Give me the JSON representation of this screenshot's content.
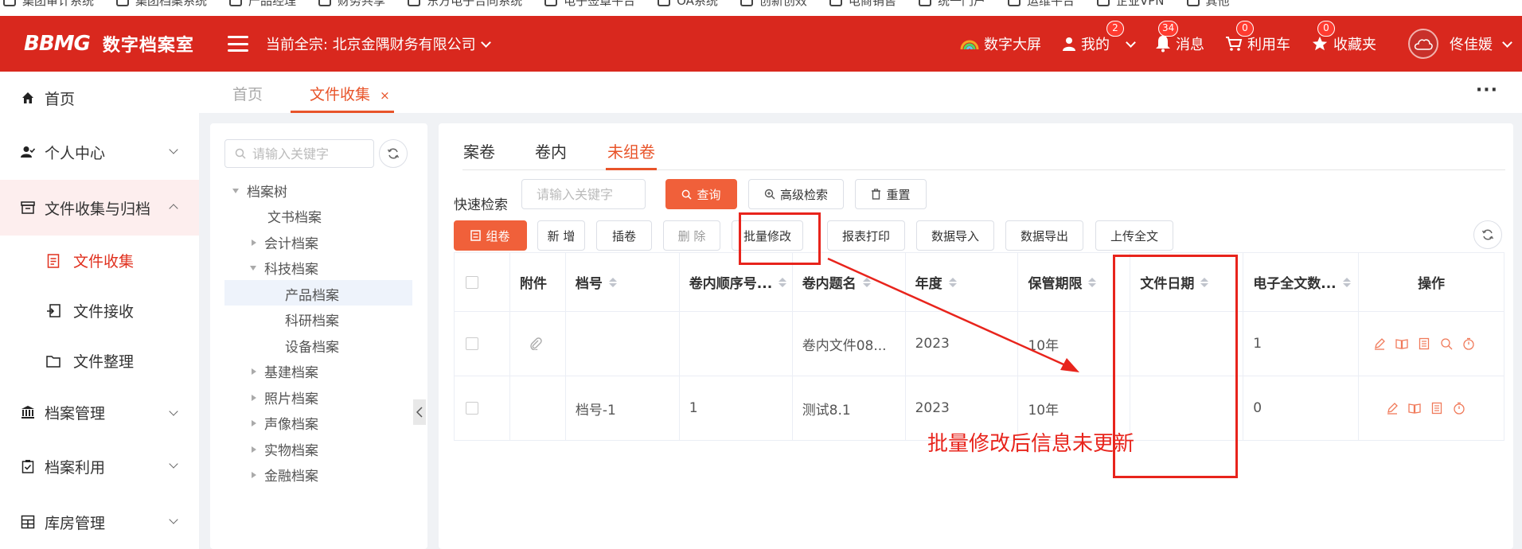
{
  "browser": {
    "bookmarks": [
      "集团审计系统",
      "集团档案系统",
      "产品经理",
      "财务共享",
      "东方电子合同系统",
      "电子签章平台",
      "OA系统",
      "创新创效",
      "电商销售",
      "统一门户",
      "运维平台",
      "企业VPN",
      "其他"
    ]
  },
  "header": {
    "logo": "BBMG",
    "title": "数字档案室",
    "company_label": "当前全宗: 北京金隅财务有限公司",
    "big_screen": "数字大屏",
    "mine": "我的",
    "mine_badge": "2",
    "messages": "消息",
    "messages_badge": "34",
    "cart": "利用车",
    "cart_badge": "0",
    "favorites": "收藏夹",
    "favorites_badge": "0",
    "user": "佟佳媛"
  },
  "sidebar": {
    "items": [
      {
        "label": "首页"
      },
      {
        "label": "个人中心"
      },
      {
        "label": "文件收集与归档"
      },
      {
        "label": "文件收集"
      },
      {
        "label": "文件接收"
      },
      {
        "label": "文件整理"
      },
      {
        "label": "档案管理"
      },
      {
        "label": "档案利用"
      },
      {
        "label": "库房管理"
      }
    ]
  },
  "page_tabs": {
    "home": "首页",
    "current": "文件收集",
    "close": "×"
  },
  "tree": {
    "search_placeholder": "请输入关键字",
    "nodes": [
      "档案树",
      "文书档案",
      "会计档案",
      "科技档案",
      "产品档案",
      "科研档案",
      "设备档案",
      "基建档案",
      "照片档案",
      "声像档案",
      "实物档案",
      "金融档案"
    ]
  },
  "content_tabs": [
    "案卷",
    "卷内",
    "未组卷"
  ],
  "toolbar": {
    "quick_search_label": "快速检索",
    "quick_search_placeholder": "请输入关键字",
    "query": "查询",
    "advanced": "高级检索",
    "reset": "重置",
    "group": "组卷",
    "add": "新 增",
    "insert": "插卷",
    "delete": "删 除",
    "batch_edit": "批量修改",
    "print": "报表打印",
    "import": "数据导入",
    "export": "数据导出",
    "upload": "上传全文"
  },
  "table": {
    "headers": [
      "附件",
      "档号",
      "卷内顺序号...",
      "卷内题名",
      "年度",
      "保管期限",
      "文件日期",
      "电子全文数...",
      "操作"
    ],
    "rows": [
      {
        "attach": "📎",
        "code": "",
        "seq": "",
        "title": "卷内文件08...",
        "year": "2023",
        "period": "10年",
        "date": "",
        "count": "1"
      },
      {
        "attach": "",
        "code": "档号-1",
        "seq": "1",
        "title": "测试8.1",
        "year": "2023",
        "period": "10年",
        "date": "",
        "count": "0"
      }
    ]
  },
  "annotation": {
    "text": "批量修改后信息未更新",
    "color": "#e8241c"
  },
  "colors": {
    "brand": "#d9281e",
    "accent": "#e8542a"
  }
}
